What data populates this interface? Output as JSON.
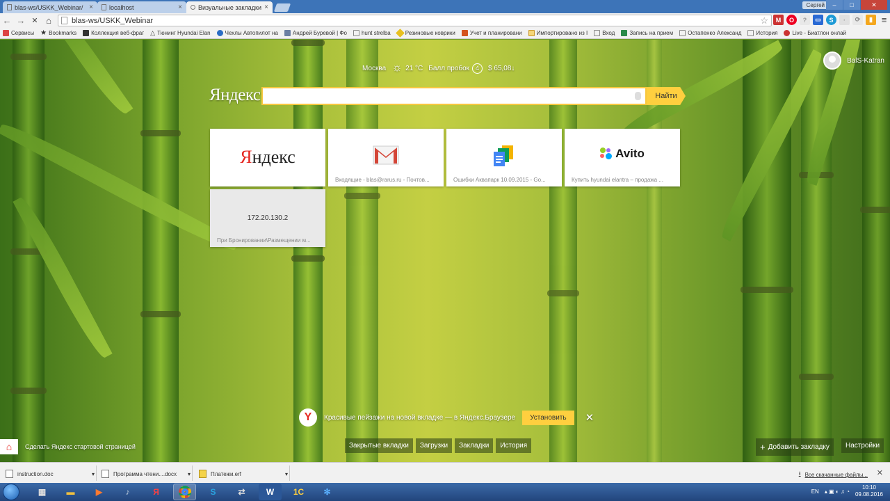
{
  "tabs": [
    {
      "title": "blas-ws/USKK_Webinar/",
      "close": "×"
    },
    {
      "title": "localhost",
      "close": "×"
    },
    {
      "title": "Визуальные закладки",
      "close": "×"
    }
  ],
  "window": {
    "user": "Сергей",
    "minimize": "–",
    "maximize": "□",
    "close": "✕"
  },
  "toolbar": {
    "back": "←",
    "forward": "→",
    "reload": "✕",
    "home": "⌂",
    "address": "blas-ws/USKK_Webinar",
    "star": "☆",
    "menu": "≡"
  },
  "bookmarks": [
    {
      "label": "Сервисы",
      "color": "#d44"
    },
    {
      "label": "Bookmarks",
      "color": "#555"
    },
    {
      "label": "Коллекция веб-фраг",
      "color": "#333"
    },
    {
      "label": "Тюнинг Hyundai Elan",
      "color": "#222"
    },
    {
      "label": "Чехлы Автопилот на",
      "color": "#2a6cc4"
    },
    {
      "label": "Андрей Буревой | Фо",
      "color": "#6b7fa3"
    },
    {
      "label": "hunt strelba",
      "color": "#888"
    },
    {
      "label": "Резиновые коврики",
      "color": "#e8c020"
    },
    {
      "label": "Учет и планировани",
      "color": "#d4541e"
    },
    {
      "label": "Импортировано из I",
      "color": "#d9a430"
    },
    {
      "label": "Вход",
      "color": "#888"
    },
    {
      "label": "Запись на прием",
      "color": "#2a8a4a"
    },
    {
      "label": "Остапенко Александ",
      "color": "#888"
    },
    {
      "label": "История",
      "color": "#888"
    },
    {
      "label": "Live - Биатлон онлай",
      "color": "#c33"
    }
  ],
  "weather": {
    "city": "Москва",
    "temp": "21 °C",
    "traffic_label": "Балл пробок",
    "traffic_score": "4",
    "currency": "$ 65,08↓"
  },
  "profile": {
    "name": "BalS-Katran"
  },
  "search": {
    "logo": "Яндекс",
    "button": "Найти"
  },
  "tiles": [
    {
      "logo_main": "Я",
      "logo_rest": "ндекс",
      "caption": ""
    },
    {
      "caption": "Входящие - blas@rarus.ru - Почтов..."
    },
    {
      "caption": "Ошибки Аквапарк 10.09.2015 - Go..."
    },
    {
      "logo": "Avito",
      "caption": "Купить hyundai elantra – продажа ..."
    },
    {
      "ip": "172.20.130.2",
      "caption": "При Бронировании\\Размещении м..."
    }
  ],
  "promo": {
    "icon": "Y",
    "text": "Красивые пейзажи на новой вкладке — в Яндекс.Браузере",
    "install": "Установить",
    "close": "✕"
  },
  "bottom": {
    "make_home": "Сделать Яндекс стартовой страницей",
    "closed_tabs": "Закрытые вкладки",
    "downloads": "Загрузки",
    "bookmarks": "Закладки",
    "history": "История",
    "add_bookmark": "Добавить закладку",
    "settings": "Настройки"
  },
  "downloads_bar": {
    "items": [
      "instruction.doc",
      "Программа чтени....docx",
      "Платежи.erf"
    ],
    "all": "Все скачанные файлы...",
    "close": "✕"
  },
  "taskbar": {
    "lang": "EN",
    "time": "10:10",
    "date": "09.08.2016"
  },
  "colors": {
    "accent": "#ffcf3f",
    "yandex_red": "#e52620",
    "taskbar": "#2b5190"
  }
}
